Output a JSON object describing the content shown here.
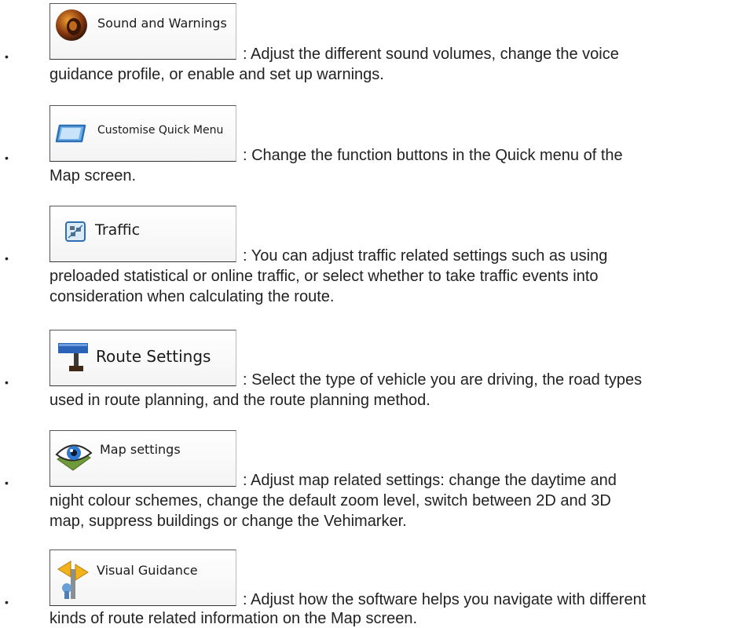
{
  "items": [
    {
      "button_label": "Sound and Warnings",
      "icon": "speaker-icon",
      "lines": [
        ": Adjust the different sound volumes, change the voice",
        "guidance profile, or enable and set up warnings."
      ]
    },
    {
      "button_label": "Customise Quick Menu",
      "icon": "quick-menu-icon",
      "lines": [
        ": Change the function buttons in the Quick menu of the",
        "Map screen."
      ]
    },
    {
      "button_label": "Traffic",
      "icon": "traffic-icon",
      "lines": [
        ": You can adjust traffic related settings such as using",
        "preloaded statistical or online traffic, or select whether to take traffic events into",
        "consideration when calculating the route."
      ]
    },
    {
      "button_label": "Route Settings",
      "icon": "route-settings-icon",
      "lines": [
        ": Select the type of vehicle you are driving, the road types",
        "used in route planning, and the route planning method."
      ]
    },
    {
      "button_label": "Map settings",
      "icon": "eye-map-icon",
      "lines": [
        ": Adjust map related settings: change the daytime and",
        "night colour schemes, change the default zoom level, switch between 2D and 3D",
        "map, suppress buildings or change the Vehimarker."
      ]
    },
    {
      "button_label": "Visual Guidance",
      "icon": "signpost-icon",
      "lines": [
        ": Adjust how the software helps you navigate with different",
        "kinds of route related information on the Map screen."
      ]
    }
  ],
  "bullet_char": "•"
}
